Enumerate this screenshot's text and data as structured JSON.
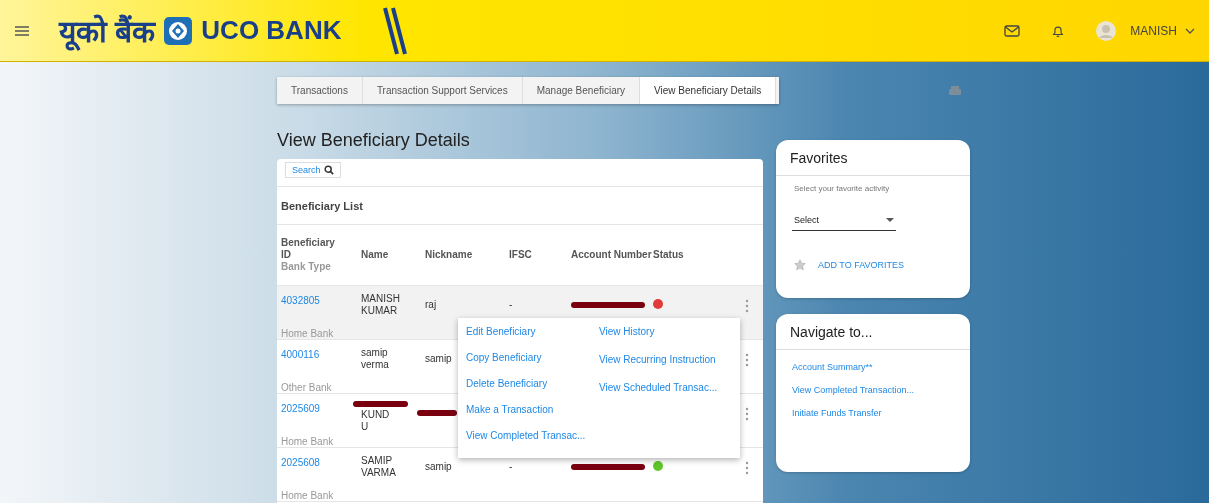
{
  "header": {
    "logo_hindi": "यूको बैंक",
    "logo_text": "UCO BANK",
    "user": "MANISH"
  },
  "breadcrumb": [
    {
      "label": "Transactions",
      "selected": false
    },
    {
      "label": "Transaction Support Services",
      "selected": false
    },
    {
      "label": "Manage Beneficiary",
      "selected": false
    },
    {
      "label": "View Beneficiary Details",
      "selected": true
    }
  ],
  "page_title": "View Beneficiary Details",
  "search": {
    "label": "Search"
  },
  "list_title": "Beneficiary List",
  "columns": [
    {
      "lines": [
        "Beneficiary",
        "ID"
      ],
      "sub": "Bank Type"
    },
    {
      "lines": [
        "Name"
      ]
    },
    {
      "lines": [
        "Nickname"
      ]
    },
    {
      "lines": [
        "IFSC"
      ]
    },
    {
      "lines": [
        "Account Number"
      ]
    },
    {
      "lines": [
        "Status"
      ]
    }
  ],
  "rows": [
    {
      "id": "4032805",
      "bank_type": "Home Bank",
      "name_lines": [
        "MANISH",
        "KUMAR"
      ],
      "nickname": "raj",
      "ifsc": "-",
      "account_redacted": true,
      "color": "#e03a3a",
      "selected": true
    },
    {
      "id": "4000116",
      "bank_type": "Other Bank",
      "name_lines": [
        "samip",
        "verma"
      ],
      "nickname": "samip",
      "selected": false
    },
    {
      "id": "2025609",
      "bank_type": "Home Bank",
      "name_lines": [
        "KUND",
        "U"
      ],
      "name_redacted": true,
      "nickname_redacted": true,
      "selected": false
    },
    {
      "id": "2025608",
      "bank_type": "Home Bank",
      "name_lines": [
        "SAMIP",
        "VARMA"
      ],
      "nickname": "samip",
      "ifsc": "-",
      "account_redacted": true,
      "color": "#5ec62a",
      "selected": false
    }
  ],
  "row_menu": {
    "left": [
      "Edit Beneficiary",
      "Copy Beneficiary",
      "Delete Beneficiary",
      "Make a Transaction",
      "View Completed Transac..."
    ],
    "right": [
      "View History",
      "View Recurring Instruction",
      "View Scheduled Transac..."
    ]
  },
  "favorites": {
    "title": "Favorites",
    "hint": "Select your favorite activity",
    "select": "Select",
    "action": "ADD TO FAVORITES"
  },
  "navigate": {
    "title": "Navigate to...",
    "links": [
      "Account Summary**",
      "View Completed Transaction...",
      "Initiate Funds Transfer"
    ]
  }
}
